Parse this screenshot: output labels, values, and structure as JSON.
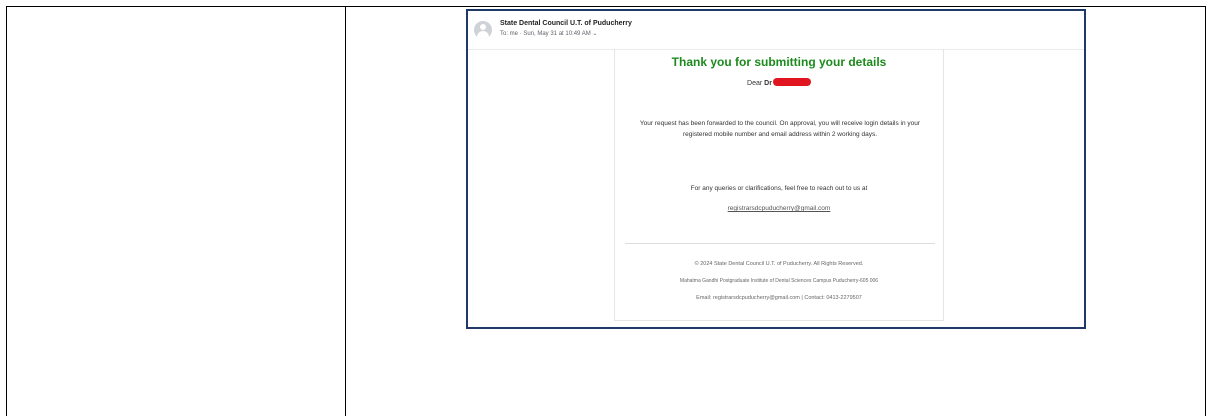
{
  "email": {
    "sender": "State Dental Council U.T. of Puducherry",
    "meta": "To: me · Sun, May 31 at 10:49 AM",
    "title": "Thank you for submitting your details",
    "greeting": "Dear ",
    "greeting_name": "Dr",
    "body": "Your request has been forwarded to the council. On approval, you will receive login details in your registered mobile number and email address within 2 working days.",
    "queries": "For any queries or clarifications, feel free to reach out to us at",
    "contact_email": "registrarsdcpuducherry@gmail.com",
    "footer": {
      "copyright": "© 2024 State Dental Council U.T. of Puducherry. All Rights Reserved.",
      "address": "Mahatma Gandhi Postgraduate Institute of Dental Sciences Campus Puducherry-605 006",
      "contact": "Email: registrarsdcpuducherry@gmail.com  |  Contact: 0413-2279507"
    }
  },
  "colors": {
    "title_green": "#1c8a1c",
    "redaction_red": "#e0151f",
    "frame_blue": "#1f3a68"
  },
  "icons": {
    "avatar": "user-avatar-icon",
    "chevron": "chevron-down-icon"
  }
}
